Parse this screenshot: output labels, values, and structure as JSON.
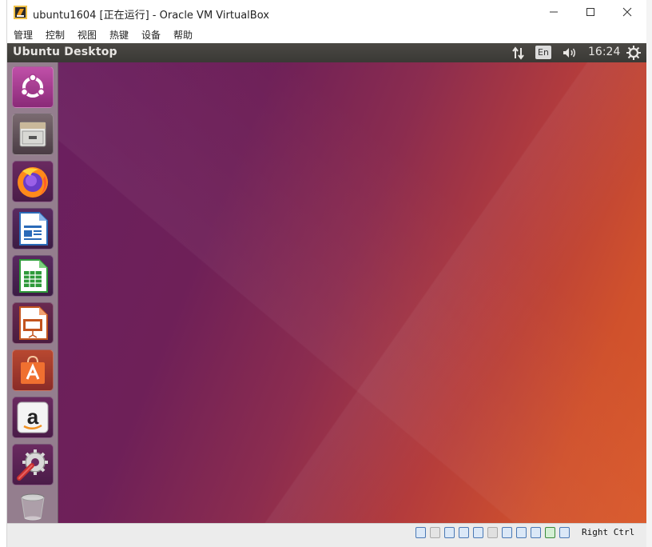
{
  "window": {
    "title": "ubuntu1604 [正在运行] - Oracle VM VirtualBox",
    "controls": [
      "minimize",
      "maximize",
      "close"
    ]
  },
  "menubar": {
    "items": [
      "管理",
      "控制",
      "视图",
      "热键",
      "设备",
      "帮助"
    ]
  },
  "guest_panel": {
    "title": "Ubuntu Desktop",
    "keyboard_layout": "En",
    "clock": "16:24",
    "indicators": [
      "network-arrows-icon",
      "keyboard-layout-indicator",
      "volume-icon",
      "clock",
      "session-gear-icon"
    ]
  },
  "launcher": {
    "items": [
      {
        "name": "dash-home",
        "icon": "ubuntu-logo-icon"
      },
      {
        "name": "files",
        "icon": "file-cabinet-icon"
      },
      {
        "name": "firefox",
        "icon": "firefox-icon"
      },
      {
        "name": "libreoffice-writer",
        "icon": "writer-document-icon"
      },
      {
        "name": "libreoffice-calc",
        "icon": "calc-spreadsheet-icon"
      },
      {
        "name": "libreoffice-impress",
        "icon": "impress-presentation-icon"
      },
      {
        "name": "ubuntu-software",
        "icon": "software-bag-icon"
      },
      {
        "name": "amazon",
        "icon": "amazon-icon"
      },
      {
        "name": "system-settings",
        "icon": "settings-wrench-gear-icon"
      },
      {
        "name": "trash",
        "icon": "trash-icon"
      }
    ]
  },
  "statusbar": {
    "host_key": "Right Ctrl",
    "icons": [
      "hard-disk-icon",
      "optical-drive-icon",
      "audio-icon",
      "network-icon",
      "usb-icon",
      "shared-folders-icon",
      "display-icon",
      "video-capture-icon",
      "virtualization-icon",
      "mouse-integration-icon",
      "keyboard-icon"
    ]
  },
  "colors": {
    "desktop_left": "#6a1f5f",
    "desktop_right": "#d9592a",
    "panel": "#3c3b37"
  }
}
